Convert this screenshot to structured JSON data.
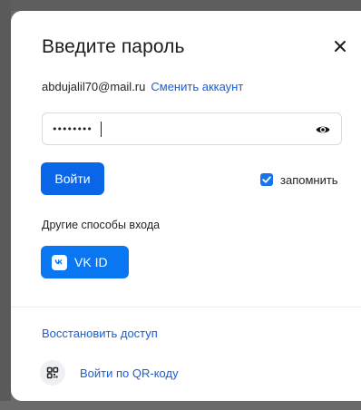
{
  "dialog": {
    "title": "Введите пароль",
    "close_icon": "close-icon"
  },
  "account": {
    "email": "abdujalil70@mail.ru",
    "switch_label": "Сменить аккаунт"
  },
  "password": {
    "value": "••••••••",
    "toggle_icon": "eye-icon"
  },
  "actions": {
    "login_label": "Войти",
    "remember_label": "запомнить",
    "remember_checked": true
  },
  "alternatives": {
    "heading": "Другие способы входа",
    "vk_label": "VK ID",
    "vk_icon": "vk-logo-icon"
  },
  "footer": {
    "restore_label": "Восстановить доступ",
    "qr_label": "Войти по QR-коду",
    "qr_icon": "qr-code-icon"
  },
  "colors": {
    "primary": "#0a66e8",
    "vk": "#0a77f2",
    "link": "#1a5ed6",
    "checkbox": "#1a73e8"
  }
}
